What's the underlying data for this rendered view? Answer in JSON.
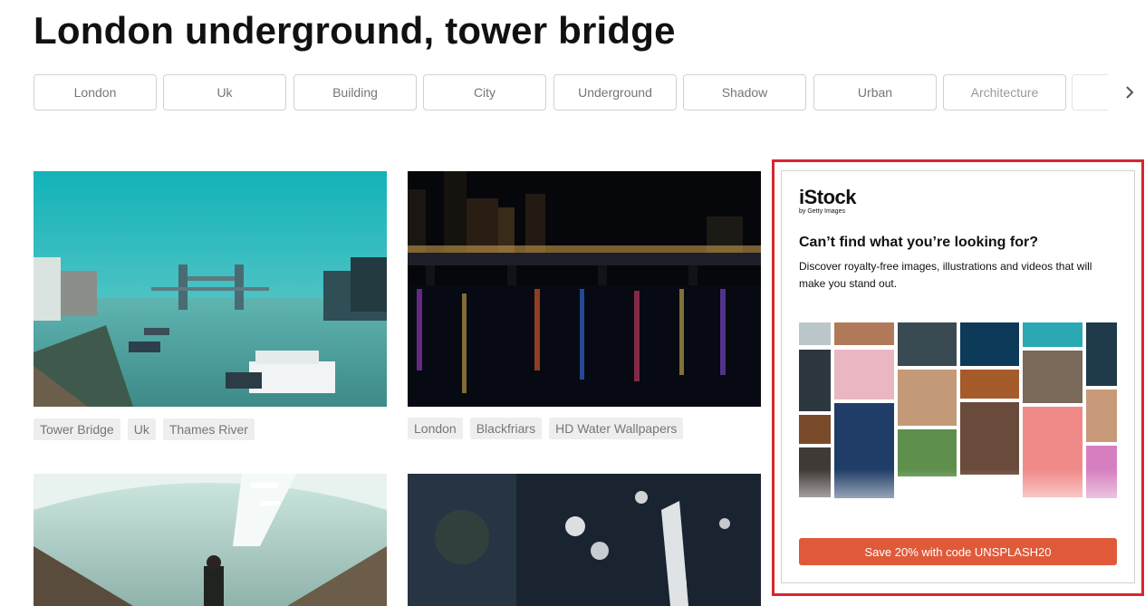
{
  "page": {
    "title": "London underground, tower bridge"
  },
  "related_tags": [
    "London",
    "Uk",
    "Building",
    "City",
    "Underground",
    "Shadow",
    "Urban",
    "Architecture"
  ],
  "icons": {
    "next": "chevron-right-icon"
  },
  "photos": [
    {
      "name": "tower-bridge-photo",
      "tags": [
        "Tower Bridge",
        "Uk",
        "Thames River"
      ]
    },
    {
      "name": "blackfriars-night-photo",
      "tags": [
        "London",
        "Blackfriars",
        "HD Water Wallpapers"
      ]
    },
    {
      "name": "underground-tunnel-photo",
      "tags": []
    },
    {
      "name": "bokeh-lights-photo",
      "tags": []
    }
  ],
  "ad": {
    "brand": "iStock",
    "brand_sub": "by Getty Images",
    "heading": "Can’t find what you’re looking for?",
    "description": "Discover royalty-free images, illustrations and videos that will make you stand out.",
    "cta": "Save 20% with code UNSPLASH20"
  },
  "colors": {
    "highlight": "#d7262f",
    "cta": "#e05a3a",
    "tag_text": "#767676"
  }
}
